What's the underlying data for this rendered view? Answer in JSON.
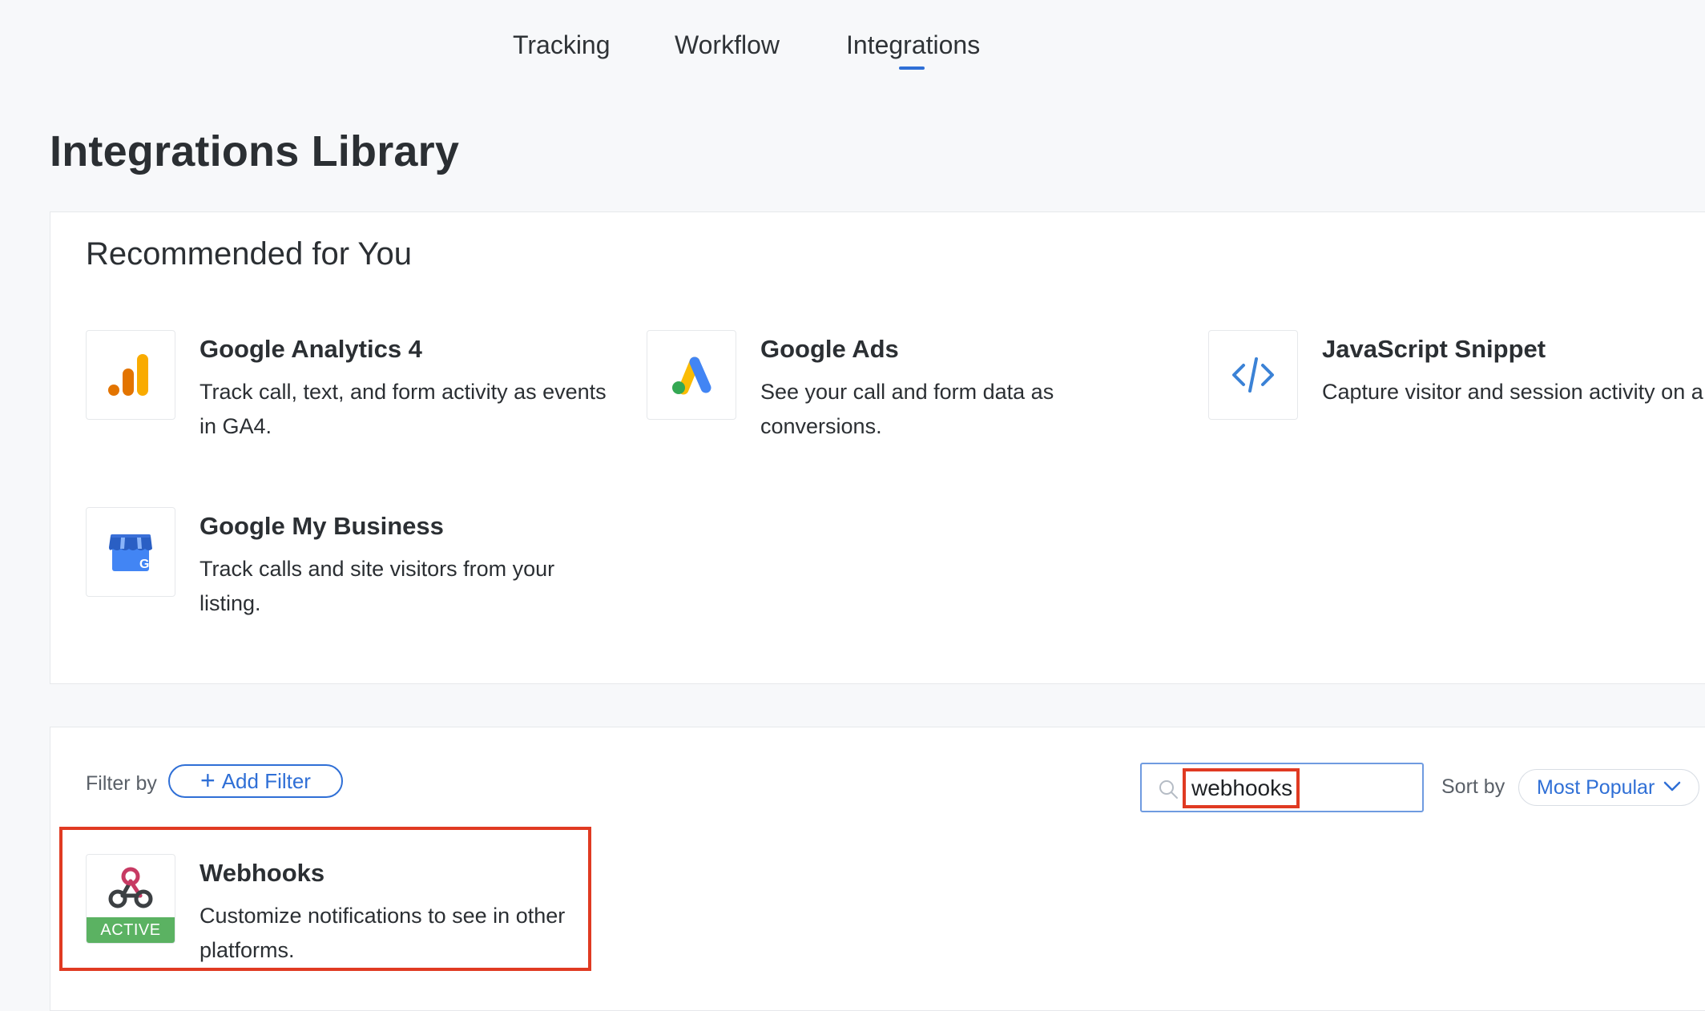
{
  "nav": {
    "tabs": [
      {
        "label": "Tracking"
      },
      {
        "label": "Workflow"
      },
      {
        "label": "Integrations",
        "active": true
      }
    ]
  },
  "page": {
    "title": "Integrations Library"
  },
  "recommended": {
    "title": "Recommended for You",
    "items": [
      {
        "name": "Google Analytics 4",
        "description": "Track call, text, and form activity as events in GA4.",
        "icon": "google-analytics-icon"
      },
      {
        "name": "Google Ads",
        "description": "See your call and form data as conversions.",
        "icon": "google-ads-icon"
      },
      {
        "name": "JavaScript Snippet",
        "description": "Capture visitor and session activity on a site.",
        "icon": "code-icon"
      },
      {
        "name": "Google My Business",
        "description": "Track calls and site visitors from your listing.",
        "icon": "google-my-business-icon"
      }
    ]
  },
  "library": {
    "filter_label": "Filter by",
    "add_filter_label": "Add Filter",
    "search": {
      "value": "webhooks"
    },
    "sort_label": "Sort by",
    "sort_value": "Most Popular",
    "results": [
      {
        "name": "Webhooks",
        "description": "Customize notifications to see in other platforms.",
        "badge": "ACTIVE",
        "icon": "webhook-icon"
      }
    ]
  },
  "colors": {
    "accent": "#2f6fd6",
    "highlight": "#e03a22",
    "active_badge": "#5bb262"
  }
}
